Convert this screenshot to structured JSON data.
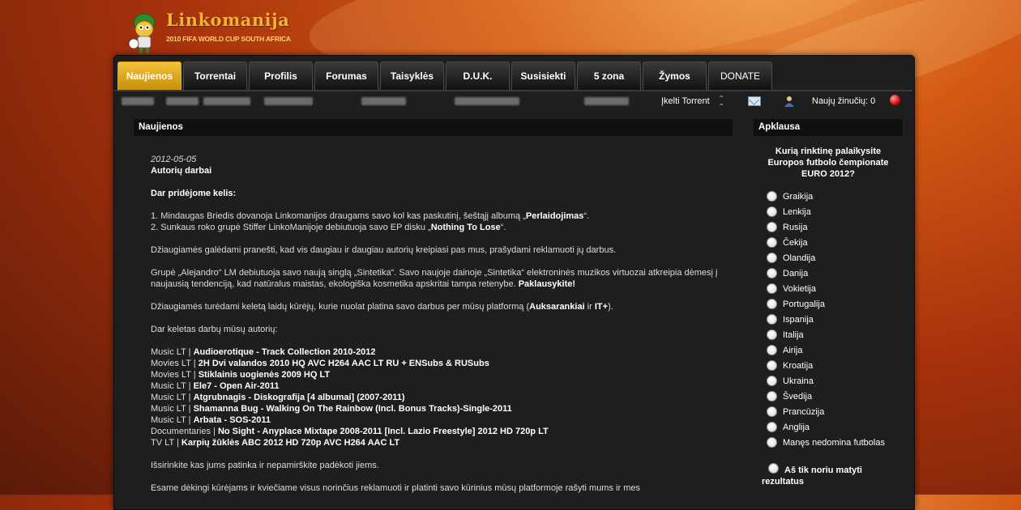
{
  "logo": {
    "title": "Linkomanija",
    "subtitle": "2010 FIFA WORLD CUP SOUTH AFRICA"
  },
  "nav": {
    "tabs": [
      "Naujienos",
      "Torrentai",
      "Profilis",
      "Forumas",
      "Taisyklės",
      "D.U.K.",
      "Susisiekti",
      "5 zona",
      "Žymos",
      "DONATE"
    ],
    "active_tab": "Naujienos"
  },
  "userbar": {
    "upload_label": "Įkelti Torrent",
    "messages_label": "Naujų žinučių: 0",
    "icons": [
      "arrow-up-icon",
      "mail-icon",
      "user-icon",
      "status-dot-icon"
    ]
  },
  "news": {
    "heading": "Naujienos",
    "date": "2012-05-05",
    "title": "Autorių darbai",
    "added_heading": "Dar pridėjome kelis:",
    "item1_prefix": "1. Mindaugas Briedis dovanoja Linkomanijos draugams savo kol kas paskutinį, šeštąjį albumą „",
    "item1_bold": "Perlaidojimas",
    "item1_suffix": "“.",
    "item2_prefix": "2. Sunkaus roko grupė Stiffer LinkoManijoje debiutuoja savo EP disku „",
    "item2_bold": "Nothing To Lose",
    "item2_suffix": "“.",
    "para1": "Džiaugiamės galėdami pranešti, kad vis daugiau ir daugiau autorių kreipiasi pas mus, prašydami reklamuoti jų darbus.",
    "para2_text": "Grupė „Alejandro“ LM debiutuoja savo naują singlą „Sintetika“. Savo naujoje dainoje „Sintetika“ elektroninės muzikos virtuozai atkreipia dėmesį į naujausią tendenciją, kad natūralus maistas, ekologiška kosmetika apskritai tampa retenybe.",
    "para2_bold": "Paklausykite!",
    "para3_prefix": "Džiaugiamės turėdami keletą laidų kūrėjų, kurie nuolat platina savo darbus per mūsų platformą (",
    "para3_bold1": "Auksarankiai",
    "para3_mid": " ir ",
    "para3_bold2": "IT+",
    "para3_suffix": ").",
    "list_heading": "Dar keletas darbų mūsų autorių:",
    "works": [
      {
        "category": "Music LT | ",
        "title": "Audioerotique - Track Collection 2010-2012"
      },
      {
        "category": "Movies LT | ",
        "title": "2H Dvi valandos 2010 HQ AVC H264 AAC LT RU + ENSubs & RUSubs"
      },
      {
        "category": "Movies LT | ",
        "title": "Stiklainis uogienės 2009 HQ LT"
      },
      {
        "category": "Music LT | ",
        "title": "Ele7 - Open Air-2011"
      },
      {
        "category": "Music LT | ",
        "title": "Atgrubnagis - Diskografija [4 albumai] (2007-2011)"
      },
      {
        "category": "Music LT | ",
        "title": "Shamanna Bug - Walking On The Rainbow (Incl. Bonus Tracks)-Single-2011"
      },
      {
        "category": "Music LT | ",
        "title": "Arbata - SOS-2011"
      },
      {
        "category": "Documentaries | ",
        "title": "No Sight - Anyplace Mixtape 2008-2011 [Incl. Lazio Freestyle] 2012 HD 720p LT"
      },
      {
        "category": "TV LT | ",
        "title": "Karpių žūklės ABC 2012 HD 720p AVC H264 AAC LT"
      }
    ],
    "closing": "Išsirinkite kas jums patinka ir nepamirškite padėkoti jiems.",
    "last_line": "Esame dėkingi kūrėjams ir kviečiame visus norinčius reklamuoti ir platinti savo kūrinius mūsų platformoje rašyti mums ir mes"
  },
  "poll": {
    "heading": "Apklausa",
    "question": "Kurią rinktinę palaikysite Europos futbolo čempionate EURO 2012?",
    "options": [
      "Graikija",
      "Lenkija",
      "Rusija",
      "Čekija",
      "Olandija",
      "Danija",
      "Vokietija",
      "Portugalija",
      "Ispanija",
      "Italija",
      "Airija",
      "Kroatija",
      "Ukraina",
      "Švedija",
      "Prancūzija",
      "Anglija",
      "Manęs nedomina futbolas"
    ],
    "results_label": "Aš tik noriu matyti rezultatus"
  }
}
